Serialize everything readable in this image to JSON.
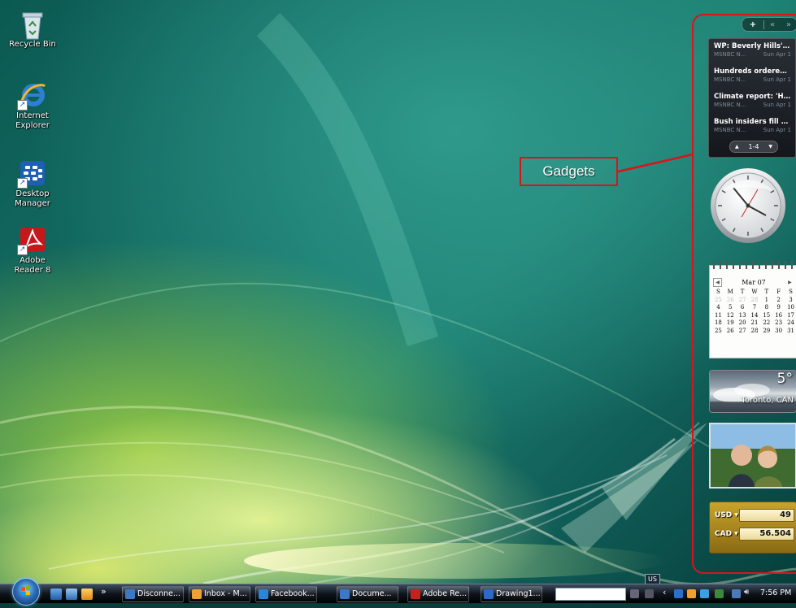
{
  "desktop": {
    "icons": [
      {
        "label": "Recycle Bin",
        "icon": "recycle-bin-icon"
      },
      {
        "label": "Internet\nExplorer",
        "icon": "internet-explorer-icon"
      },
      {
        "label": "Desktop\nManager",
        "icon": "blackberry-desktop-manager-icon"
      },
      {
        "label": "Adobe\nReader 8",
        "icon": "adobe-reader-icon"
      }
    ]
  },
  "annotation": {
    "label": "Gadgets",
    "color": "#d9141b"
  },
  "sidebar": {
    "controls": {
      "add": "+",
      "prev": "«",
      "next": "»"
    },
    "news": {
      "items": [
        {
          "headline": "WP: Beverly Hills' Ir...",
          "source": "MSNBC N...",
          "date": "Sun Apr 1"
        },
        {
          "headline": "Hundreds ordered to ...",
          "source": "MSNBC N...",
          "date": "Sun Apr 1"
        },
        {
          "headline": "Climate report: 'High...",
          "source": "MSNBC N...",
          "date": "Sun Apr 1"
        },
        {
          "headline": "Bush insiders fill pro...",
          "source": "MSNBC N...",
          "date": "Sun Apr 1"
        }
      ],
      "pager": "1-4",
      "up": "▲",
      "down": "▼"
    },
    "calendar": {
      "month": "Mar 07",
      "prev": "◀",
      "next": "▶",
      "weekdays": [
        "S",
        "M",
        "T",
        "W",
        "T",
        "F",
        "S"
      ],
      "weeks": [
        [
          "25",
          "26",
          "27",
          "28",
          "1",
          "2",
          "3"
        ],
        [
          "4",
          "5",
          "6",
          "7",
          "8",
          "9",
          "10"
        ],
        [
          "11",
          "12",
          "13",
          "14",
          "15",
          "16",
          "17"
        ],
        [
          "18",
          "19",
          "20",
          "21",
          "22",
          "23",
          "24"
        ],
        [
          "25",
          "26",
          "27",
          "28",
          "29",
          "30",
          "31"
        ]
      ]
    },
    "weather": {
      "temp": "5°",
      "city": "Toronto, CAN"
    },
    "currency": {
      "rows": [
        {
          "code": "USD ▾",
          "value": "49"
        },
        {
          "code": "CAD ▾",
          "value": "56.504"
        }
      ]
    }
  },
  "taskbar": {
    "overflow": "»",
    "tasks": [
      {
        "label": "Disconne...",
        "color": "#3a78c8"
      },
      {
        "label": "Inbox - M...",
        "color": "#f0a030"
      },
      {
        "label": "Facebook...",
        "color": "#2a84d8"
      },
      {
        "label": "Docume...",
        "color": "#3a78c8"
      },
      {
        "label": "Adobe Re...",
        "color": "#c8201a"
      },
      {
        "label": "Drawing1...",
        "color": "#2a6ac8"
      }
    ],
    "language": "US",
    "time": "7:56 PM"
  }
}
